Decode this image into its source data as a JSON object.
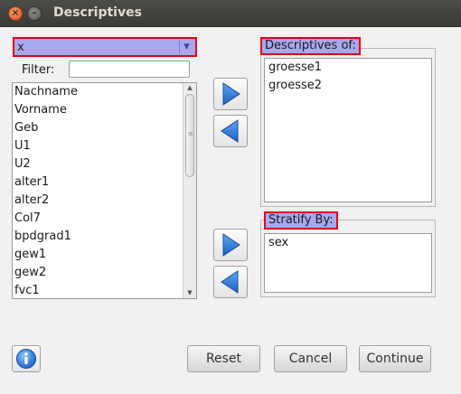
{
  "window": {
    "title": "Descriptives",
    "close_glyph": "×",
    "minimize_glyph": "–"
  },
  "variable_selector": {
    "value": "x",
    "filter_label": "Filter:",
    "filter_value": "",
    "variables": [
      "Nachname",
      "Vorname",
      "Geb",
      "U1",
      "U2",
      "alter1",
      "alter2",
      "Col7",
      "bpdgrad1",
      "gew1",
      "gew2",
      "fvc1"
    ]
  },
  "descriptives": {
    "title": "Descriptives of:",
    "items": [
      "groesse1",
      "groesse2"
    ]
  },
  "stratify": {
    "title": "Stratify By:",
    "items": [
      "sex"
    ]
  },
  "buttons": {
    "reset": "Reset",
    "cancel": "Cancel",
    "continue": "Continue"
  },
  "icons": {
    "add_descriptives": "arrow-right-icon",
    "remove_descriptives": "arrow-left-icon",
    "add_stratify": "arrow-right-icon",
    "remove_stratify": "arrow-left-icon",
    "info": "info-icon"
  },
  "colors": {
    "highlight_fill": "#a8a8f0",
    "highlight_border": "#e0001a",
    "arrow_blue": "#2a78d8"
  }
}
